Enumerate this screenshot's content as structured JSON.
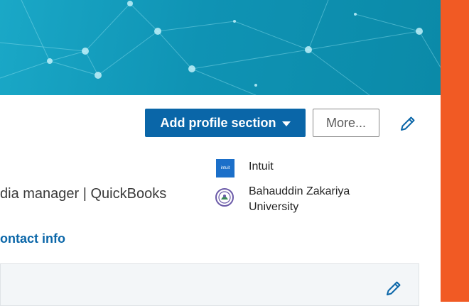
{
  "profile": {
    "add_section_label": "Add profile section",
    "more_label": "More...",
    "headline": "dia manager | QuickBooks",
    "contact_info_label": "ontact info"
  },
  "organizations": [
    {
      "logo_text": "intuit",
      "name": "Intuit",
      "logo_color": "#1b6fc9"
    },
    {
      "name_line1": "Bahauddin Zakariya",
      "name_line2": "University"
    }
  ],
  "colors": {
    "banner": "#0f93b4",
    "primary_button": "#0a66a8",
    "side_strip": "#f15a24",
    "link": "#0a66a8"
  },
  "icons": {
    "edit": "pencil-icon",
    "dropdown": "caret-down-icon"
  }
}
